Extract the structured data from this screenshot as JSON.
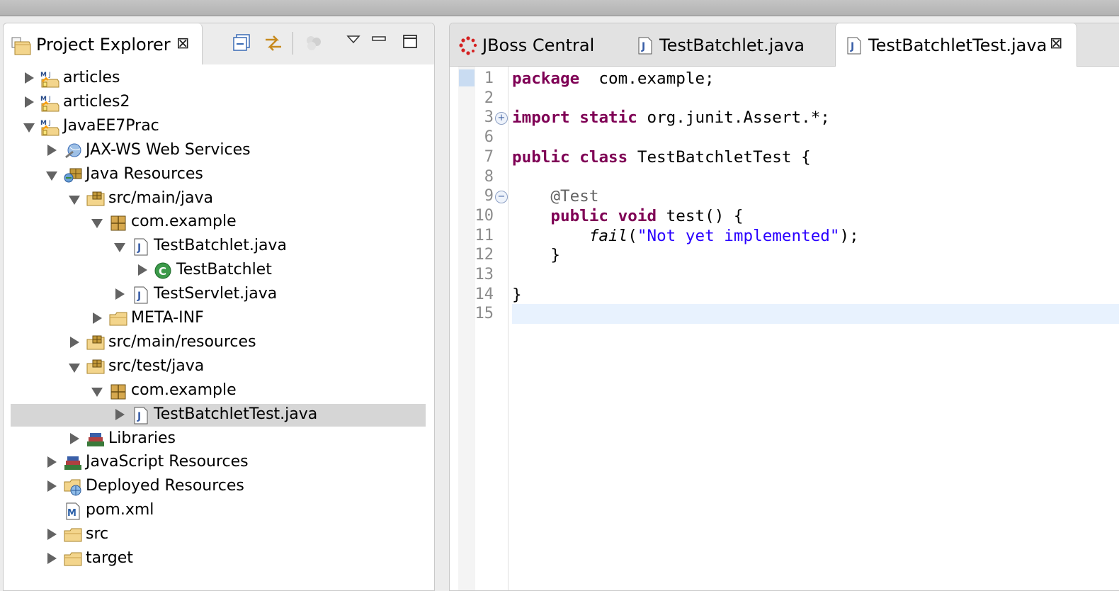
{
  "left_panel": {
    "tab_title": "Project Explorer",
    "tab_close": "⊠",
    "toolbar": {
      "collapse_all": "collapse-all-icon",
      "link_editor": "link-with-editor-icon",
      "other": "disabled-action-icon",
      "view_menu": "view-menu-icon",
      "minimize": "minimize-icon",
      "maximize": "maximize-icon"
    },
    "tree": [
      {
        "label": "articles",
        "depth": 0,
        "state": "collapsed",
        "icon": "maven-project-icon"
      },
      {
        "label": "articles2",
        "depth": 0,
        "state": "collapsed",
        "icon": "maven-project-icon"
      },
      {
        "label": "JavaEE7Prac",
        "depth": 0,
        "state": "expanded",
        "icon": "maven-project-icon"
      },
      {
        "label": "JAX-WS Web Services",
        "depth": 1,
        "state": "collapsed",
        "icon": "web-services-icon"
      },
      {
        "label": "Java Resources",
        "depth": 1,
        "state": "expanded",
        "icon": "java-resources-icon"
      },
      {
        "label": "src/main/java",
        "depth": 2,
        "state": "expanded",
        "icon": "source-folder-icon"
      },
      {
        "label": "com.example",
        "depth": 3,
        "state": "expanded",
        "icon": "package-icon"
      },
      {
        "label": "TestBatchlet.java",
        "depth": 4,
        "state": "expanded",
        "icon": "java-file-icon"
      },
      {
        "label": "TestBatchlet",
        "depth": 5,
        "state": "collapsed",
        "icon": "class-icon"
      },
      {
        "label": "TestServlet.java",
        "depth": 4,
        "state": "collapsed",
        "icon": "java-file-icon"
      },
      {
        "label": "META-INF",
        "depth": 3,
        "state": "collapsed",
        "icon": "folder-icon"
      },
      {
        "label": "src/main/resources",
        "depth": 2,
        "state": "collapsed",
        "icon": "source-folder-icon"
      },
      {
        "label": "src/test/java",
        "depth": 2,
        "state": "expanded",
        "icon": "source-folder-icon"
      },
      {
        "label": "com.example",
        "depth": 3,
        "state": "expanded",
        "icon": "package-icon"
      },
      {
        "label": "TestBatchletTest.java",
        "depth": 4,
        "state": "collapsed",
        "icon": "java-file-icon",
        "selected": true
      },
      {
        "label": "Libraries",
        "depth": 2,
        "state": "collapsed",
        "icon": "libraries-icon"
      },
      {
        "label": "JavaScript Resources",
        "depth": 1,
        "state": "collapsed",
        "icon": "libraries-icon"
      },
      {
        "label": "Deployed Resources",
        "depth": 1,
        "state": "collapsed",
        "icon": "deployed-resources-icon"
      },
      {
        "label": "pom.xml",
        "depth": 1,
        "state": "none",
        "icon": "maven-pom-icon"
      },
      {
        "label": "src",
        "depth": 1,
        "state": "collapsed",
        "icon": "folder-icon"
      },
      {
        "label": "target",
        "depth": 1,
        "state": "collapsed",
        "icon": "folder-icon"
      }
    ]
  },
  "editor": {
    "tabs": [
      {
        "label": "JBoss Central",
        "icon": "jboss-central-icon",
        "active": false
      },
      {
        "label": "TestBatchlet.java",
        "icon": "java-file-icon",
        "active": false
      },
      {
        "label": "TestBatchletTest.java",
        "icon": "java-file-icon",
        "active": true,
        "close": "⊠"
      }
    ],
    "lines": [
      {
        "n": "1",
        "tokens": [
          [
            "kw",
            "package"
          ],
          [
            "",
            "  com.example;"
          ]
        ]
      },
      {
        "n": "2",
        "tokens": []
      },
      {
        "n": "3",
        "fold": "+",
        "tokens": [
          [
            "kw",
            "import"
          ],
          [
            "",
            " "
          ],
          [
            "kw",
            "static"
          ],
          [
            "",
            " org.junit.Assert.*;"
          ]
        ]
      },
      {
        "n": "6",
        "tokens": []
      },
      {
        "n": "7",
        "tokens": [
          [
            "kw",
            "public"
          ],
          [
            "",
            " "
          ],
          [
            "kw",
            "class"
          ],
          [
            "",
            " TestBatchletTest {"
          ]
        ]
      },
      {
        "n": "8",
        "tokens": []
      },
      {
        "n": "9",
        "fold": "−",
        "tokens": [
          [
            "",
            "    "
          ],
          [
            "ann",
            "@Test"
          ]
        ]
      },
      {
        "n": "10",
        "tokens": [
          [
            "",
            "    "
          ],
          [
            "kw",
            "public"
          ],
          [
            "",
            " "
          ],
          [
            "kw",
            "void"
          ],
          [
            "",
            " test() {"
          ]
        ]
      },
      {
        "n": "11",
        "tokens": [
          [
            "",
            "        "
          ],
          [
            "it",
            "fail"
          ],
          [
            "",
            "("
          ],
          [
            "str",
            "\"Not yet implemented\""
          ],
          [
            "",
            ");"
          ]
        ]
      },
      {
        "n": "12",
        "tokens": [
          [
            "",
            "    }"
          ]
        ]
      },
      {
        "n": "13",
        "tokens": []
      },
      {
        "n": "14",
        "tokens": [
          [
            "",
            "}"
          ]
        ]
      },
      {
        "n": "15",
        "tokens": [],
        "current": true
      }
    ]
  },
  "colors": {
    "keyword": "#7f0055",
    "string": "#2a00ff",
    "annotation": "#646464",
    "selection": "#d6d6d6",
    "current_line": "#e8f2fe"
  }
}
